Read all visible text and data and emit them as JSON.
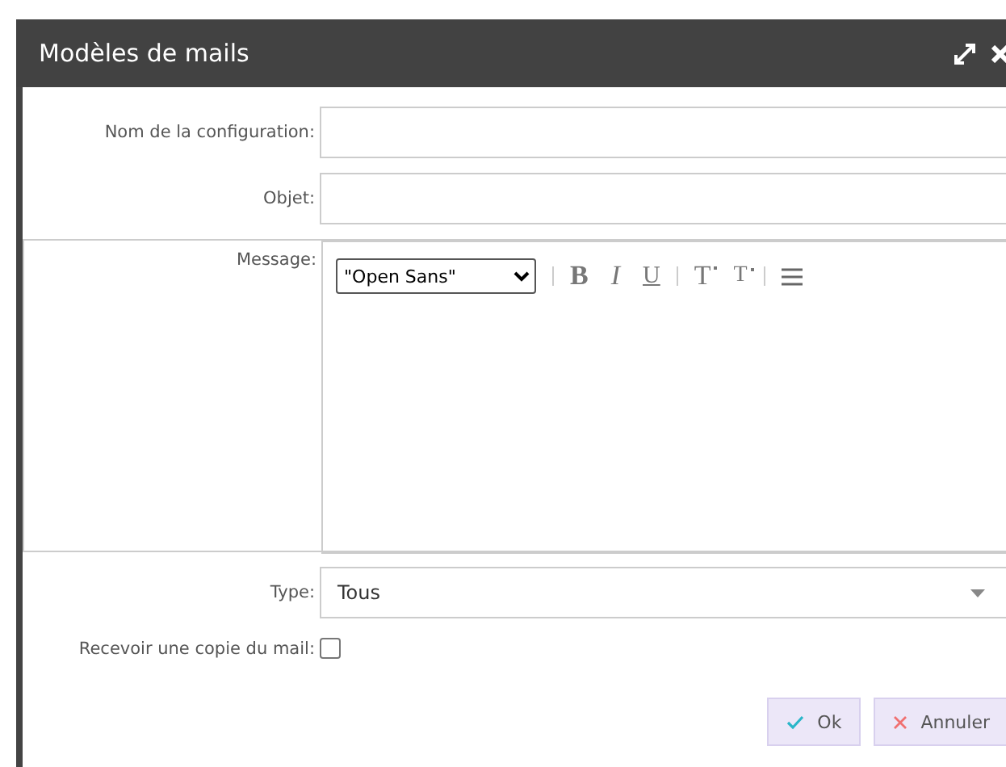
{
  "window": {
    "title": "Modèles de mails"
  },
  "fields": [
    {
      "label": "Nom de la configuration:",
      "kind": "text"
    },
    {
      "label": "Objet:",
      "kind": "text"
    },
    {
      "label": "Message:",
      "kind": "editor"
    },
    {
      "label": "Type:",
      "kind": "select",
      "value": "Tous"
    },
    {
      "label": "Recevoir une copie du mail:",
      "kind": "checkbox",
      "checked": false
    }
  ],
  "editor": {
    "font": "\"Open Sans\"",
    "tools": [
      {
        "label": "B",
        "kind": "bold"
      },
      {
        "label": "I",
        "kind": "italic"
      },
      {
        "label": "U",
        "kind": "underline"
      },
      {
        "label": "T",
        "kind": "sup"
      },
      {
        "label": "T",
        "kind": "sub"
      }
    ]
  },
  "buttons": [
    {
      "label": "Ok",
      "kind": "ok"
    },
    {
      "label": "Annuler",
      "kind": "cancel"
    }
  ]
}
